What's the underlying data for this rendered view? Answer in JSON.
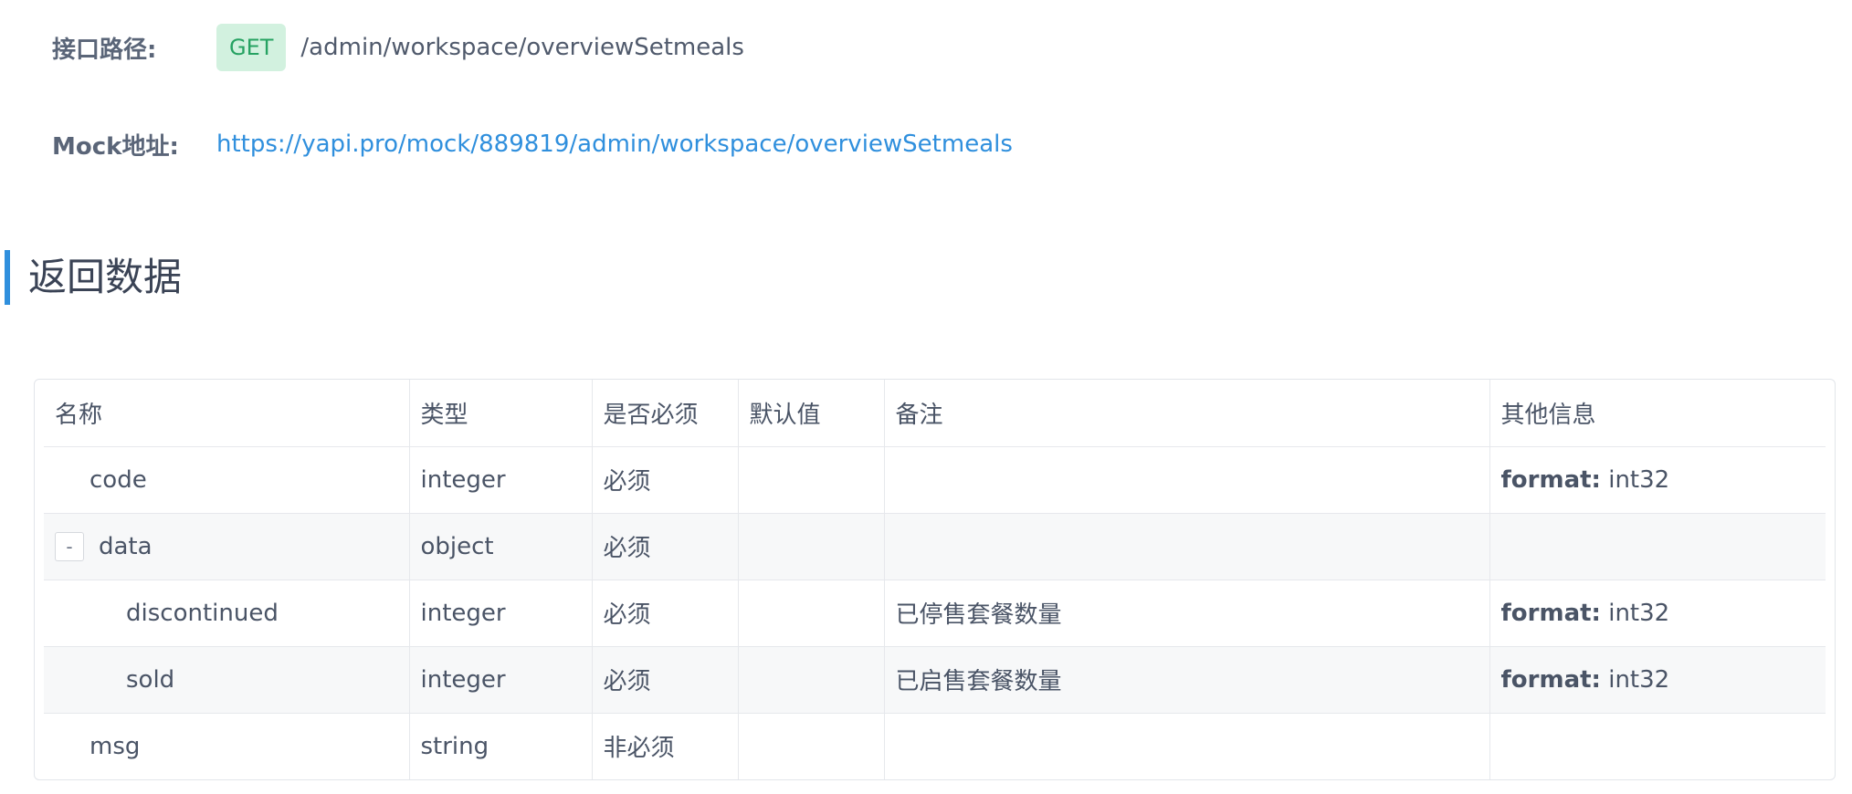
{
  "api": {
    "path_label": "接口路径:",
    "method": "GET",
    "path": "/admin/workspace/overviewSetmeals",
    "mock_label": "Mock地址:",
    "mock_url": "https://yapi.pro/mock/889819/admin/workspace/overviewSetmeals"
  },
  "section": {
    "title": "返回数据"
  },
  "table": {
    "headers": [
      "名称",
      "类型",
      "是否必须",
      "默认值",
      "备注",
      "其他信息"
    ],
    "rows": [
      {
        "name": "code",
        "type": "integer",
        "required": "必须",
        "default": "",
        "note": "",
        "fmt_key": "format:",
        "fmt_val": "int32"
      },
      {
        "toggle": "-",
        "name": "data",
        "type": "object",
        "required": "必须",
        "default": "",
        "note": "",
        "fmt_key": "",
        "fmt_val": ""
      },
      {
        "name": "discontinued",
        "type": "integer",
        "required": "必须",
        "default": "",
        "note": "已停售套餐数量",
        "fmt_key": "format:",
        "fmt_val": "int32"
      },
      {
        "name": "sold",
        "type": "integer",
        "required": "必须",
        "default": "",
        "note": "已启售套餐数量",
        "fmt_key": "format:",
        "fmt_val": "int32"
      },
      {
        "name": "msg",
        "type": "string",
        "required": "非必须",
        "default": "",
        "note": "",
        "fmt_key": "",
        "fmt_val": ""
      }
    ]
  },
  "colors": {
    "accent": "#2f8fdd",
    "method_bg": "#d2f1df",
    "method_fg": "#26a262"
  }
}
